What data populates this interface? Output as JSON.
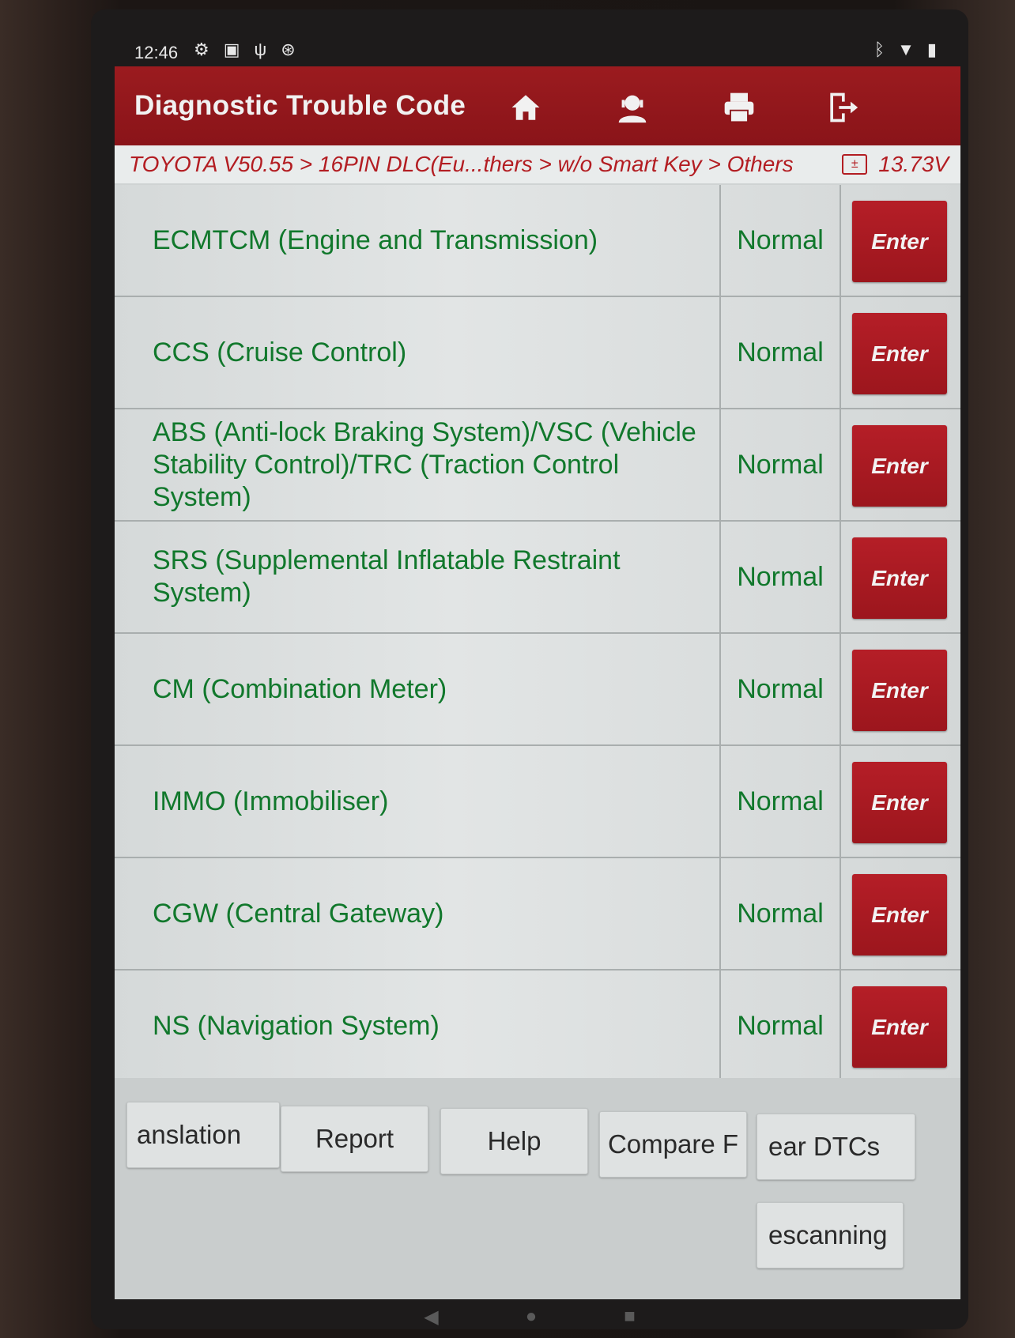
{
  "status_bar": {
    "time": "12:46",
    "left_icons": [
      "gear-icon",
      "image-icon",
      "usb-icon",
      "accessibility-icon"
    ],
    "right_icons": [
      "bluetooth-icon",
      "wifi-icon",
      "battery-icon"
    ]
  },
  "header": {
    "title": "Diagnostic Trouble Code",
    "buttons": [
      "home-icon",
      "support-icon",
      "print-icon",
      "exit-icon"
    ]
  },
  "breadcrumb": {
    "path": "TOYOTA V50.55 > 16PIN DLC(Eu...thers > w/o Smart Key > Others",
    "voltage": "13.73V"
  },
  "systems": [
    {
      "name": "ECMTCM (Engine and Transmission)",
      "status": "Normal",
      "action": "Enter"
    },
    {
      "name": "CCS (Cruise Control)",
      "status": "Normal",
      "action": "Enter"
    },
    {
      "name": "ABS (Anti-lock Braking System)/VSC (Vehicle Stability Control)/TRC (Traction Control System)",
      "status": "Normal",
      "action": "Enter"
    },
    {
      "name": "SRS (Supplemental Inflatable Restraint System)",
      "status": "Normal",
      "action": "Enter"
    },
    {
      "name": "CM (Combination Meter)",
      "status": "Normal",
      "action": "Enter"
    },
    {
      "name": "IMMO (Immobiliser)",
      "status": "Normal",
      "action": "Enter"
    },
    {
      "name": "CGW (Central Gateway)",
      "status": "Normal",
      "action": "Enter"
    },
    {
      "name": "NS (Navigation System)",
      "status": "Normal",
      "action": "Enter"
    }
  ],
  "toolbar": {
    "translation": "anslation",
    "report": "Report",
    "help": "Help",
    "compare": "Compare F",
    "clear_dtcs": "ear DTCs",
    "rescanning": "escanning"
  },
  "nav_bar": [
    "back-icon",
    "home-icon",
    "recents-icon"
  ]
}
